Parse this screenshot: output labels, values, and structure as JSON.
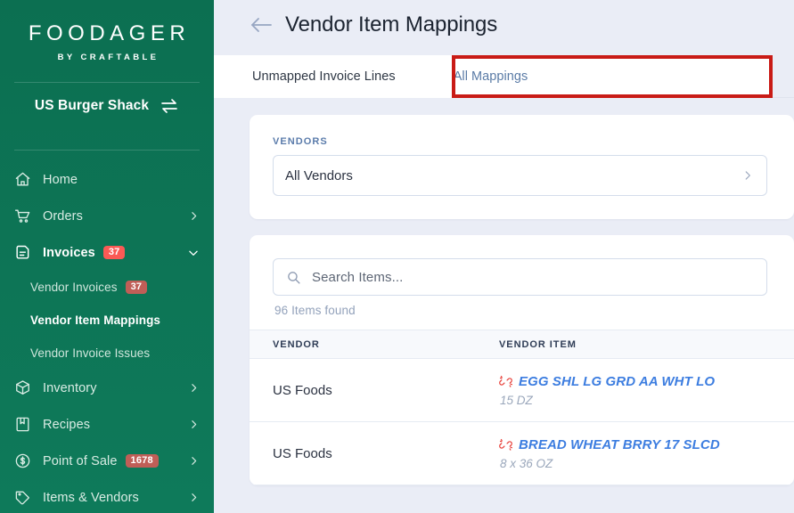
{
  "sidebar": {
    "brand": {
      "name": "FOODAGER",
      "subtitle": "BY CRAFTABLE"
    },
    "store": {
      "name": "US Burger Shack",
      "swap_icon": "swap-arrows-icon"
    },
    "items": [
      {
        "label": "Home",
        "icon": "home-icon",
        "badge": null,
        "chevron": null,
        "active": false
      },
      {
        "label": "Orders",
        "icon": "cart-icon",
        "badge": null,
        "chevron": "chevron-right-icon",
        "active": false
      },
      {
        "label": "Invoices",
        "icon": "invoice-document-icon",
        "badge": "37",
        "chevron": "chevron-down-icon",
        "active": true
      }
    ],
    "subitems": [
      {
        "label": "Vendor Invoices",
        "badge": "37",
        "active": false
      },
      {
        "label": "Vendor Item Mappings",
        "badge": null,
        "active": true
      },
      {
        "label": "Vendor Invoice Issues",
        "badge": null,
        "active": false
      }
    ],
    "items_lower": [
      {
        "label": "Inventory",
        "icon": "box-icon",
        "badge": null,
        "chevron": "chevron-right-icon",
        "active": false
      },
      {
        "label": "Recipes",
        "icon": "book-icon",
        "badge": null,
        "chevron": "chevron-right-icon",
        "active": false
      },
      {
        "label": "Point of Sale",
        "icon": "dollar-circle-icon",
        "badge": "1678",
        "chevron": "chevron-right-icon",
        "active": false
      },
      {
        "label": "Items & Vendors",
        "icon": "tag-icon",
        "badge": null,
        "chevron": "chevron-right-icon",
        "active": false
      }
    ],
    "colors": {
      "background": "#0d7355",
      "badge_bright": "#fa5a55",
      "badge_muted": "#c05e57"
    }
  },
  "header": {
    "back_icon": "arrow-left-icon",
    "title": "Vendor Item Mappings"
  },
  "tabs": {
    "current": "Unmapped Invoice Lines",
    "other": "All Mappings",
    "highlight_color": "#c91b16"
  },
  "vendors_card": {
    "label": "VENDORS",
    "selected": "All Vendors",
    "chevron_icon": "chevron-right-icon"
  },
  "list_card": {
    "search": {
      "icon": "search-icon",
      "placeholder": "Search Items..."
    },
    "results_text": "96 Items found",
    "columns": [
      "VENDOR",
      "VENDOR ITEM"
    ],
    "rows": [
      {
        "vendor": "US Foods",
        "item_icon": "unlink-icon",
        "item_name": "EGG SHL LG GRD AA WHT LO",
        "item_size": "15 DZ"
      },
      {
        "vendor": "US Foods",
        "item_icon": "unlink-icon",
        "item_name": "BREAD WHEAT BRRY 17 SLCD",
        "item_size": "8 x 36 OZ"
      }
    ]
  }
}
